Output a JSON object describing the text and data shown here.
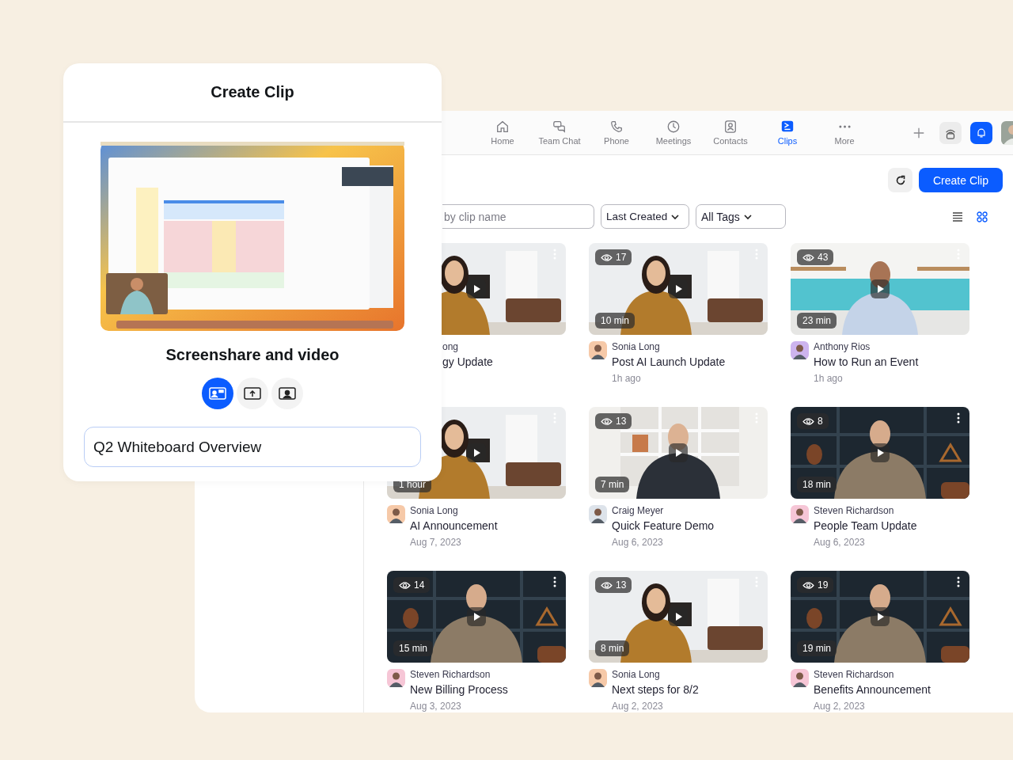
{
  "nav": {
    "items": [
      {
        "label": "Home",
        "selected": false
      },
      {
        "label": "Team Chat",
        "selected": false
      },
      {
        "label": "Phone",
        "selected": false
      },
      {
        "label": "Meetings",
        "selected": false
      },
      {
        "label": "Contacts",
        "selected": false
      },
      {
        "label": "Clips",
        "selected": true
      },
      {
        "label": "More",
        "selected": false
      }
    ]
  },
  "toolbar": {
    "create_button": "Create Clip"
  },
  "filters": {
    "search": {
      "placeholder": "by clip name"
    },
    "sort": "Last Created",
    "tags": "All Tags",
    "view_modes": [
      {
        "kind": "list",
        "selected": false
      },
      {
        "kind": "grid",
        "selected": true
      }
    ]
  },
  "clips": [
    {
      "kind": "partial",
      "author": "ong",
      "title": "gy Update"
    },
    {
      "kind": "full",
      "author": "Sonia Long",
      "title": "Post AI Launch Update",
      "date": "1h ago",
      "views": "17",
      "duration": "10 min",
      "color": "#f6c9a8"
    },
    {
      "kind": "full",
      "author": "Anthony Rios",
      "title": "How to Run an Event",
      "date": "1h ago",
      "views": "43",
      "duration": "23 min",
      "color": "#cdb4ee"
    },
    {
      "kind": "full",
      "author": "Sonia Long",
      "title": "AI Announcement",
      "date": "Aug 7, 2023",
      "duration": "1 hour",
      "color": "#f6c9a8"
    },
    {
      "kind": "full",
      "author": "Craig Meyer",
      "title": "Quick Feature Demo",
      "date": "Aug 6, 2023",
      "views": "13",
      "duration": "7 min",
      "color": "#dde3ea"
    },
    {
      "kind": "full",
      "author": "Steven Richardson",
      "title": "People Team Update",
      "date": "Aug 6, 2023",
      "views": "8",
      "duration": "18 min",
      "color": "#f6c6d6"
    },
    {
      "kind": "full",
      "author": "Steven Richardson",
      "title": "New Billing Process",
      "date": "Aug 3, 2023",
      "views": "14",
      "duration": "15 min",
      "color": "#f6c6d6"
    },
    {
      "kind": "full",
      "author": "Sonia Long",
      "title": "Next steps for 8/2",
      "date": "Aug 2, 2023",
      "views": "13",
      "duration": "8 min",
      "color": "#f6c9a8"
    },
    {
      "kind": "full",
      "author": "Steven Richardson",
      "title": "Benefits Announcement",
      "date": "Aug 2, 2023",
      "views": "19",
      "duration": "19 min",
      "color": "#f6c6d6"
    }
  ],
  "create_panel": {
    "title": "Create Clip",
    "mode_label": "Screenshare and video",
    "modes": [
      {
        "kind": "screen-video",
        "selected": true
      },
      {
        "kind": "screen",
        "selected": false
      },
      {
        "kind": "video",
        "selected": false
      }
    ],
    "clip_name": "Q2 Whiteboard Overview"
  }
}
